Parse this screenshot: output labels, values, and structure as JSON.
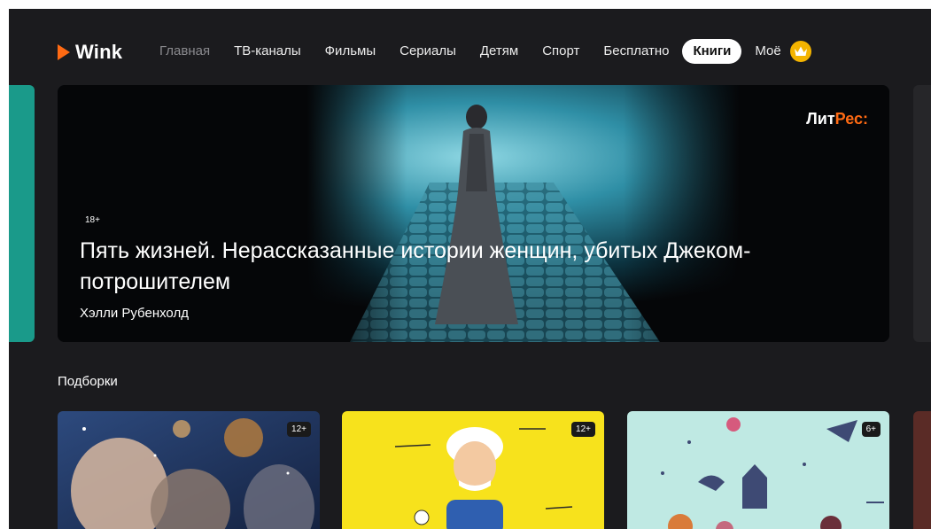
{
  "app": {
    "logo": "Wink",
    "brand_color": "#ff6a13"
  },
  "nav": {
    "items": [
      "Главная",
      "ТВ-каналы",
      "Фильмы",
      "Сериалы",
      "Детям",
      "Спорт",
      "Бесплатно",
      "Книги",
      "Моё"
    ],
    "active": "Книги"
  },
  "hero": {
    "partner_prefix": "Лит",
    "partner_suffix": "Рес:",
    "age_rating": "18+",
    "title": "Пять жизней. Нерассказанные истории женщин, убитых Джеком-потрошителем",
    "author": "Хэлли Рубенхолд"
  },
  "collections": {
    "title": "Подборки",
    "cards": [
      {
        "age": "12+",
        "theme": "space-painting"
      },
      {
        "age": "12+",
        "theme": "einstein-cartoon"
      },
      {
        "age": "6+",
        "theme": "fairy-tale-icons"
      }
    ]
  },
  "colors": {
    "background": "#1b1b1e",
    "accent": "#ff6a13",
    "card2_bg": "#f7e21c",
    "card3_bg": "#bfe9e3",
    "crown": "#f4b400"
  }
}
